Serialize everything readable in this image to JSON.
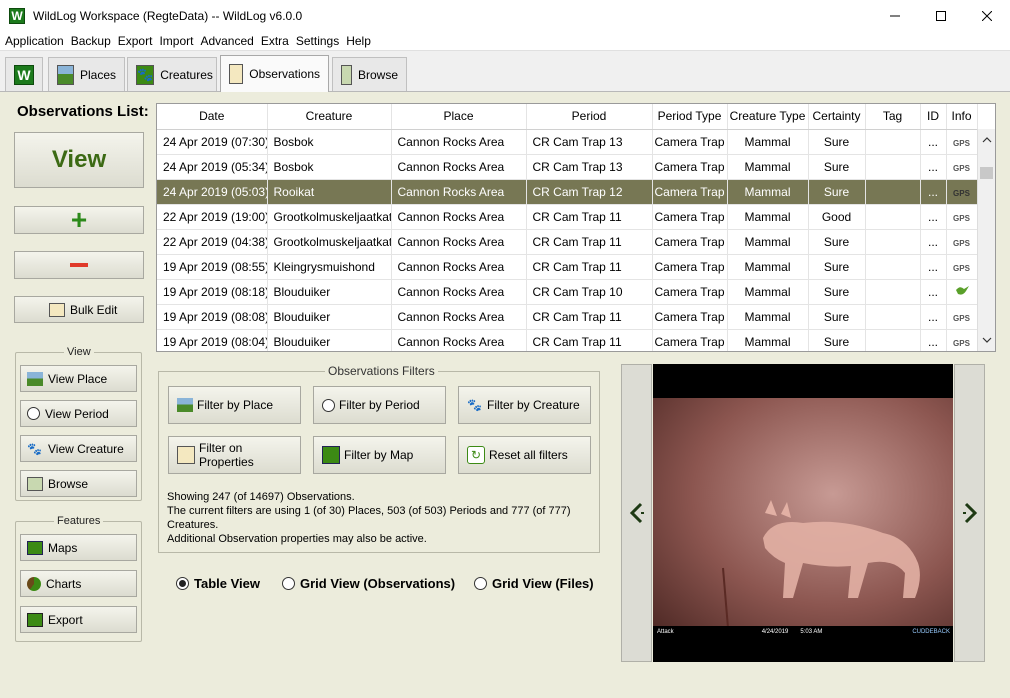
{
  "window": {
    "title": "WildLog Workspace (RegteData) -- WildLog v6.0.0",
    "icon_letter": "W"
  },
  "menu": [
    "Application",
    "Backup",
    "Export",
    "Import",
    "Advanced",
    "Extra",
    "Settings",
    "Help"
  ],
  "tabs": {
    "home_letter": "W",
    "places": "Places",
    "creatures": "Creatures",
    "observations": "Observations",
    "browse": "Browse"
  },
  "left_panel": {
    "title": "Observations List:",
    "view_button": "View",
    "add_symbol": "+",
    "remove_symbol": "−",
    "bulk_edit": "Bulk Edit",
    "view_group_title": "View",
    "view_place": "View  Place",
    "view_period": "View Period",
    "view_creature": "View Creature",
    "browse": "Browse",
    "features_group_title": "Features",
    "maps": "Maps",
    "charts": "Charts",
    "export": "Export"
  },
  "table": {
    "columns": [
      "Date",
      "Creature",
      "Place",
      "Period",
      "Period Type",
      "Creature Type",
      "Certainty",
      "Tag",
      "ID",
      "Info"
    ],
    "rows": [
      {
        "date": "24 Apr 2019 (07:30)",
        "creature": "Bosbok",
        "place": "Cannon Rocks Area",
        "period": "CR Cam Trap 13",
        "period_type": "Camera Trap",
        "creature_type": "Mammal",
        "certainty": "Sure",
        "tag": "",
        "id": "...",
        "info": "GPS"
      },
      {
        "date": "24 Apr 2019 (05:34)",
        "creature": "Bosbok",
        "place": "Cannon Rocks Area",
        "period": "CR Cam Trap 13",
        "period_type": "Camera Trap",
        "creature_type": "Mammal",
        "certainty": "Sure",
        "tag": "",
        "id": "...",
        "info": "GPS"
      },
      {
        "date": "24 Apr 2019 (05:03)",
        "creature": "Rooikat",
        "place": "Cannon Rocks Area",
        "period": "CR Cam Trap 12",
        "period_type": "Camera Trap",
        "creature_type": "Mammal",
        "certainty": "Sure",
        "tag": "",
        "id": "...",
        "info": "GPS",
        "selected": true
      },
      {
        "date": "22 Apr 2019 (19:00)",
        "creature": "Grootkolmuskeljaatkat",
        "place": "Cannon Rocks Area",
        "period": "CR Cam Trap 11",
        "period_type": "Camera Trap",
        "creature_type": "Mammal",
        "certainty": "Good",
        "tag": "",
        "id": "...",
        "info": "GPS"
      },
      {
        "date": "22 Apr 2019 (04:38)",
        "creature": "Grootkolmuskeljaatkat",
        "place": "Cannon Rocks Area",
        "period": "CR Cam Trap 11",
        "period_type": "Camera Trap",
        "creature_type": "Mammal",
        "certainty": "Sure",
        "tag": "",
        "id": "...",
        "info": "GPS"
      },
      {
        "date": "19 Apr 2019 (08:55)",
        "creature": "Kleingrysmuishond",
        "place": "Cannon Rocks Area",
        "period": "CR Cam Trap 11",
        "period_type": "Camera Trap",
        "creature_type": "Mammal",
        "certainty": "Sure",
        "tag": "",
        "id": "...",
        "info": "GPS"
      },
      {
        "date": "19 Apr 2019 (08:18)",
        "creature": "Blouduiker",
        "place": "Cannon Rocks Area",
        "period": "CR Cam Trap 10",
        "period_type": "Camera Trap",
        "creature_type": "Mammal",
        "certainty": "Sure",
        "tag": "",
        "id": "...",
        "info": "bird-icon"
      },
      {
        "date": "19 Apr 2019 (08:08)",
        "creature": "Blouduiker",
        "place": "Cannon Rocks Area",
        "period": "CR Cam Trap 11",
        "period_type": "Camera Trap",
        "creature_type": "Mammal",
        "certainty": "Sure",
        "tag": "",
        "id": "...",
        "info": "GPS"
      },
      {
        "date": "19 Apr 2019 (08:04)",
        "creature": "Blouduiker",
        "place": "Cannon Rocks Area",
        "period": "CR Cam Trap 11",
        "period_type": "Camera Trap",
        "creature_type": "Mammal",
        "certainty": "Sure",
        "tag": "",
        "id": "...",
        "info": "GPS"
      }
    ]
  },
  "filters": {
    "title": "Observations Filters",
    "by_place": "Filter by Place",
    "by_period": "Filter by Period",
    "by_creature": "Filter by Creature",
    "on_properties": "Filter on Properties",
    "by_map": "Filter by Map",
    "reset": "Reset all filters",
    "info_line1": "Showing 247 (of 14697) Observations.",
    "info_line2": "The current filters are using 1 (of 30) Places, 503 (of 503) Periods and 777 (of 777)",
    "info_line3": "Creatures.",
    "info_line4": "Additional Observation properties may also be active."
  },
  "view_modes": {
    "table": "Table View",
    "grid_obs": "Grid View (Observations)",
    "grid_files": "Grid View (Files)",
    "selected": "table"
  },
  "photo": {
    "stamp_left": "Attack",
    "stamp_date": "4/24/2019",
    "stamp_time": "5:03 AM",
    "stamp_brand": "CUDDEBACK"
  },
  "colors": {
    "accent_green": "#3c8a14",
    "remove_red": "#e03a2a",
    "selected_row": "#777754",
    "panel_bg": "#ececdc"
  }
}
